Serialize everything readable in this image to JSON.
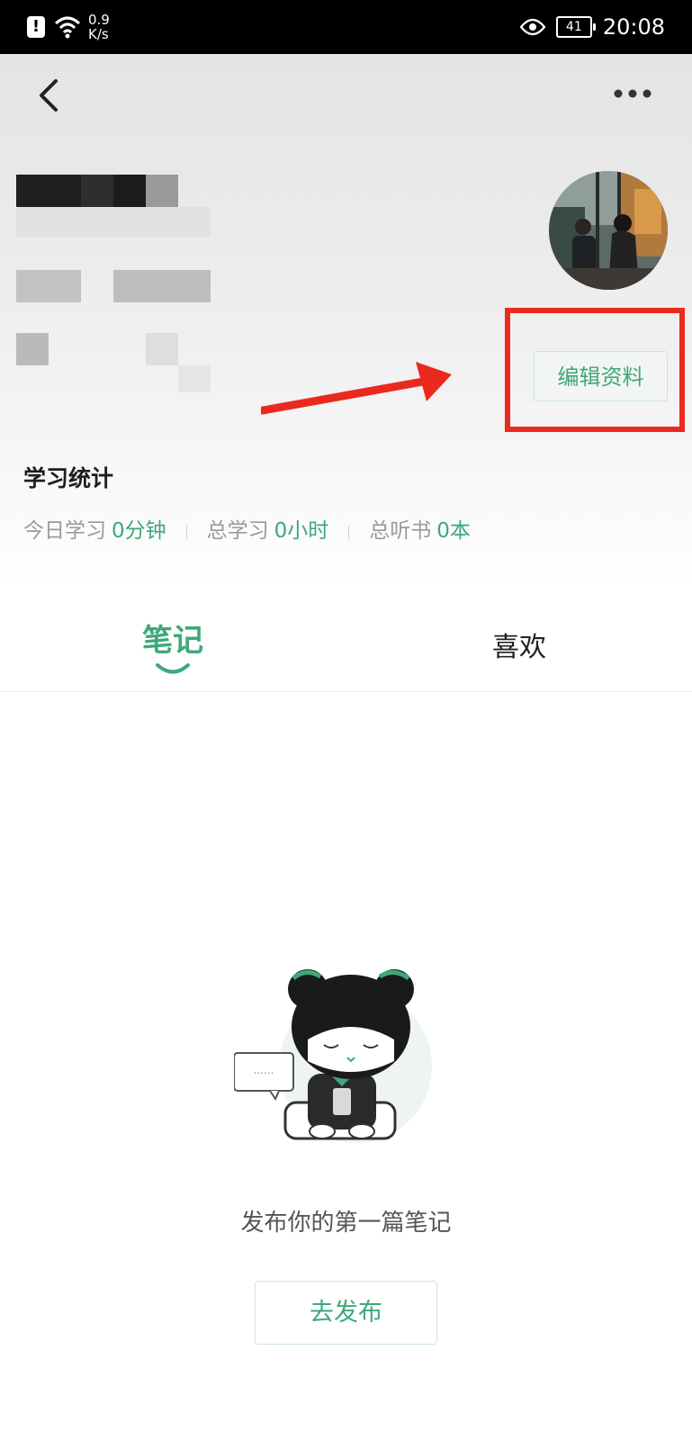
{
  "status_bar": {
    "alert_icon": "!",
    "net_speed_value": "0.9",
    "net_speed_unit": "K/s",
    "battery": "41",
    "time": "20:08"
  },
  "profile": {
    "edit_button": "编辑资料"
  },
  "stats": {
    "title": "学习统计",
    "items": [
      {
        "label": "今日学习",
        "value": "0分钟"
      },
      {
        "label": "总学习",
        "value": "0小时"
      },
      {
        "label": "总听书",
        "value": "0本"
      }
    ]
  },
  "tabs": [
    {
      "label": "笔记",
      "active": true
    },
    {
      "label": "喜欢",
      "active": false
    }
  ],
  "empty_state": {
    "message": "发布你的第一篇笔记",
    "button": "去发布"
  },
  "colors": {
    "accent": "#3ea87a",
    "annotation": "#ea2a1f"
  }
}
